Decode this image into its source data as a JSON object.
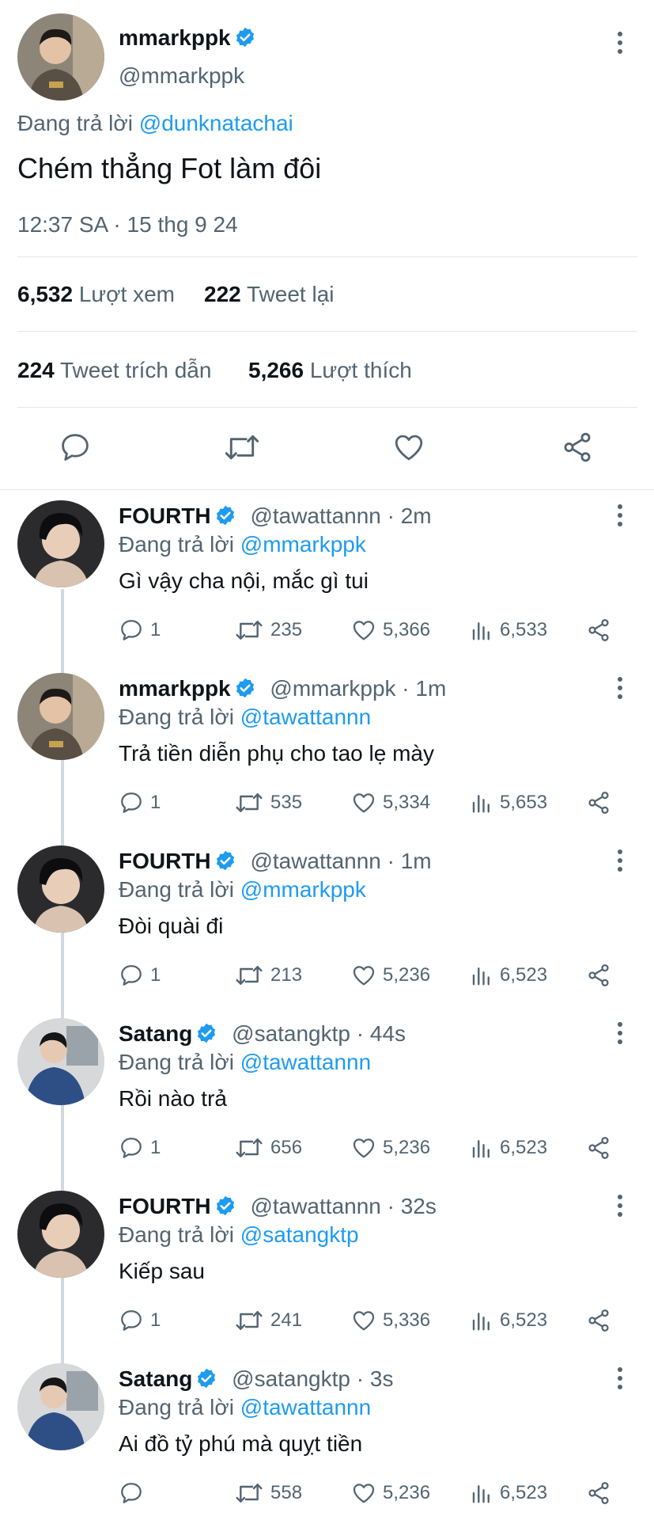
{
  "main_tweet": {
    "author_name": "mmarkppk",
    "author_handle": "@mmarkppk",
    "replying_prefix": "Đang trả lời",
    "replying_to": "@dunknatachai",
    "text": "Chém thẳng Fot làm đôi",
    "timestamp": "12:37 SA · 15 thg 9 24",
    "views_count": "6,532",
    "views_label": "Lượt xem",
    "retweets_count": "222",
    "retweets_label": "Tweet lại",
    "quotes_count": "224",
    "quotes_label": "Tweet trích dẫn",
    "likes_count": "5,266",
    "likes_label": "Lượt thích"
  },
  "replies": [
    {
      "name": "FOURTH",
      "handle": "@tawattannn · 2m",
      "replying_prefix": "Đang trả lời",
      "replying_to": "@mmarkppk",
      "text": "Gì vậy cha nội, mắc gì tui",
      "replies": "1",
      "retweets": "235",
      "likes": "5,366",
      "views": "6,533"
    },
    {
      "name": "mmarkppk",
      "handle": "@mmarkppk · 1m",
      "replying_prefix": "Đang trả lời",
      "replying_to": "@tawattannn",
      "text": "Trả tiền diễn phụ cho tao lẹ mày",
      "replies": "1",
      "retweets": "535",
      "likes": "5,334",
      "views": "5,653"
    },
    {
      "name": "FOURTH",
      "handle": "@tawattannn · 1m",
      "replying_prefix": "Đang trả lời",
      "replying_to": "@mmarkppk",
      "text": "Đòi quài đi",
      "replies": "1",
      "retweets": "213",
      "likes": "5,236",
      "views": "6,523"
    },
    {
      "name": "Satang",
      "handle": "@satangktp · 44s",
      "replying_prefix": "Đang trả lời",
      "replying_to": "@tawattannn",
      "text": "Rồi nào trả",
      "replies": "1",
      "retweets": "656",
      "likes": "5,236",
      "views": "6,523"
    },
    {
      "name": "FOURTH",
      "handle": "@tawattannn · 32s",
      "replying_prefix": "Đang trả lời",
      "replying_to": "@satangktp",
      "text": "Kiếp sau",
      "replies": "1",
      "retweets": "241",
      "likes": "5,336",
      "views": "6,523"
    },
    {
      "name": "Satang",
      "handle": "@satangktp · 3s",
      "replying_prefix": "Đang trả lời",
      "replying_to": "@tawattannn",
      "text": "Ai đồ tỷ phú mà quỵt tiền",
      "replies": "",
      "retweets": "558",
      "likes": "5,236",
      "views": "6,523"
    }
  ],
  "icons": {
    "verified": "verified-badge-icon",
    "reply": "speech-bubble-icon",
    "retweet": "retweet-arrows-icon",
    "like": "heart-icon",
    "views": "bar-chart-icon",
    "share": "share-nodes-icon",
    "more": "vertical-dots-icon"
  },
  "colors": {
    "link": "#1d9bf0",
    "verified": "#1d9bf0",
    "text_primary": "#0f1419",
    "text_secondary": "#536471",
    "divider": "#e1e6ea"
  }
}
